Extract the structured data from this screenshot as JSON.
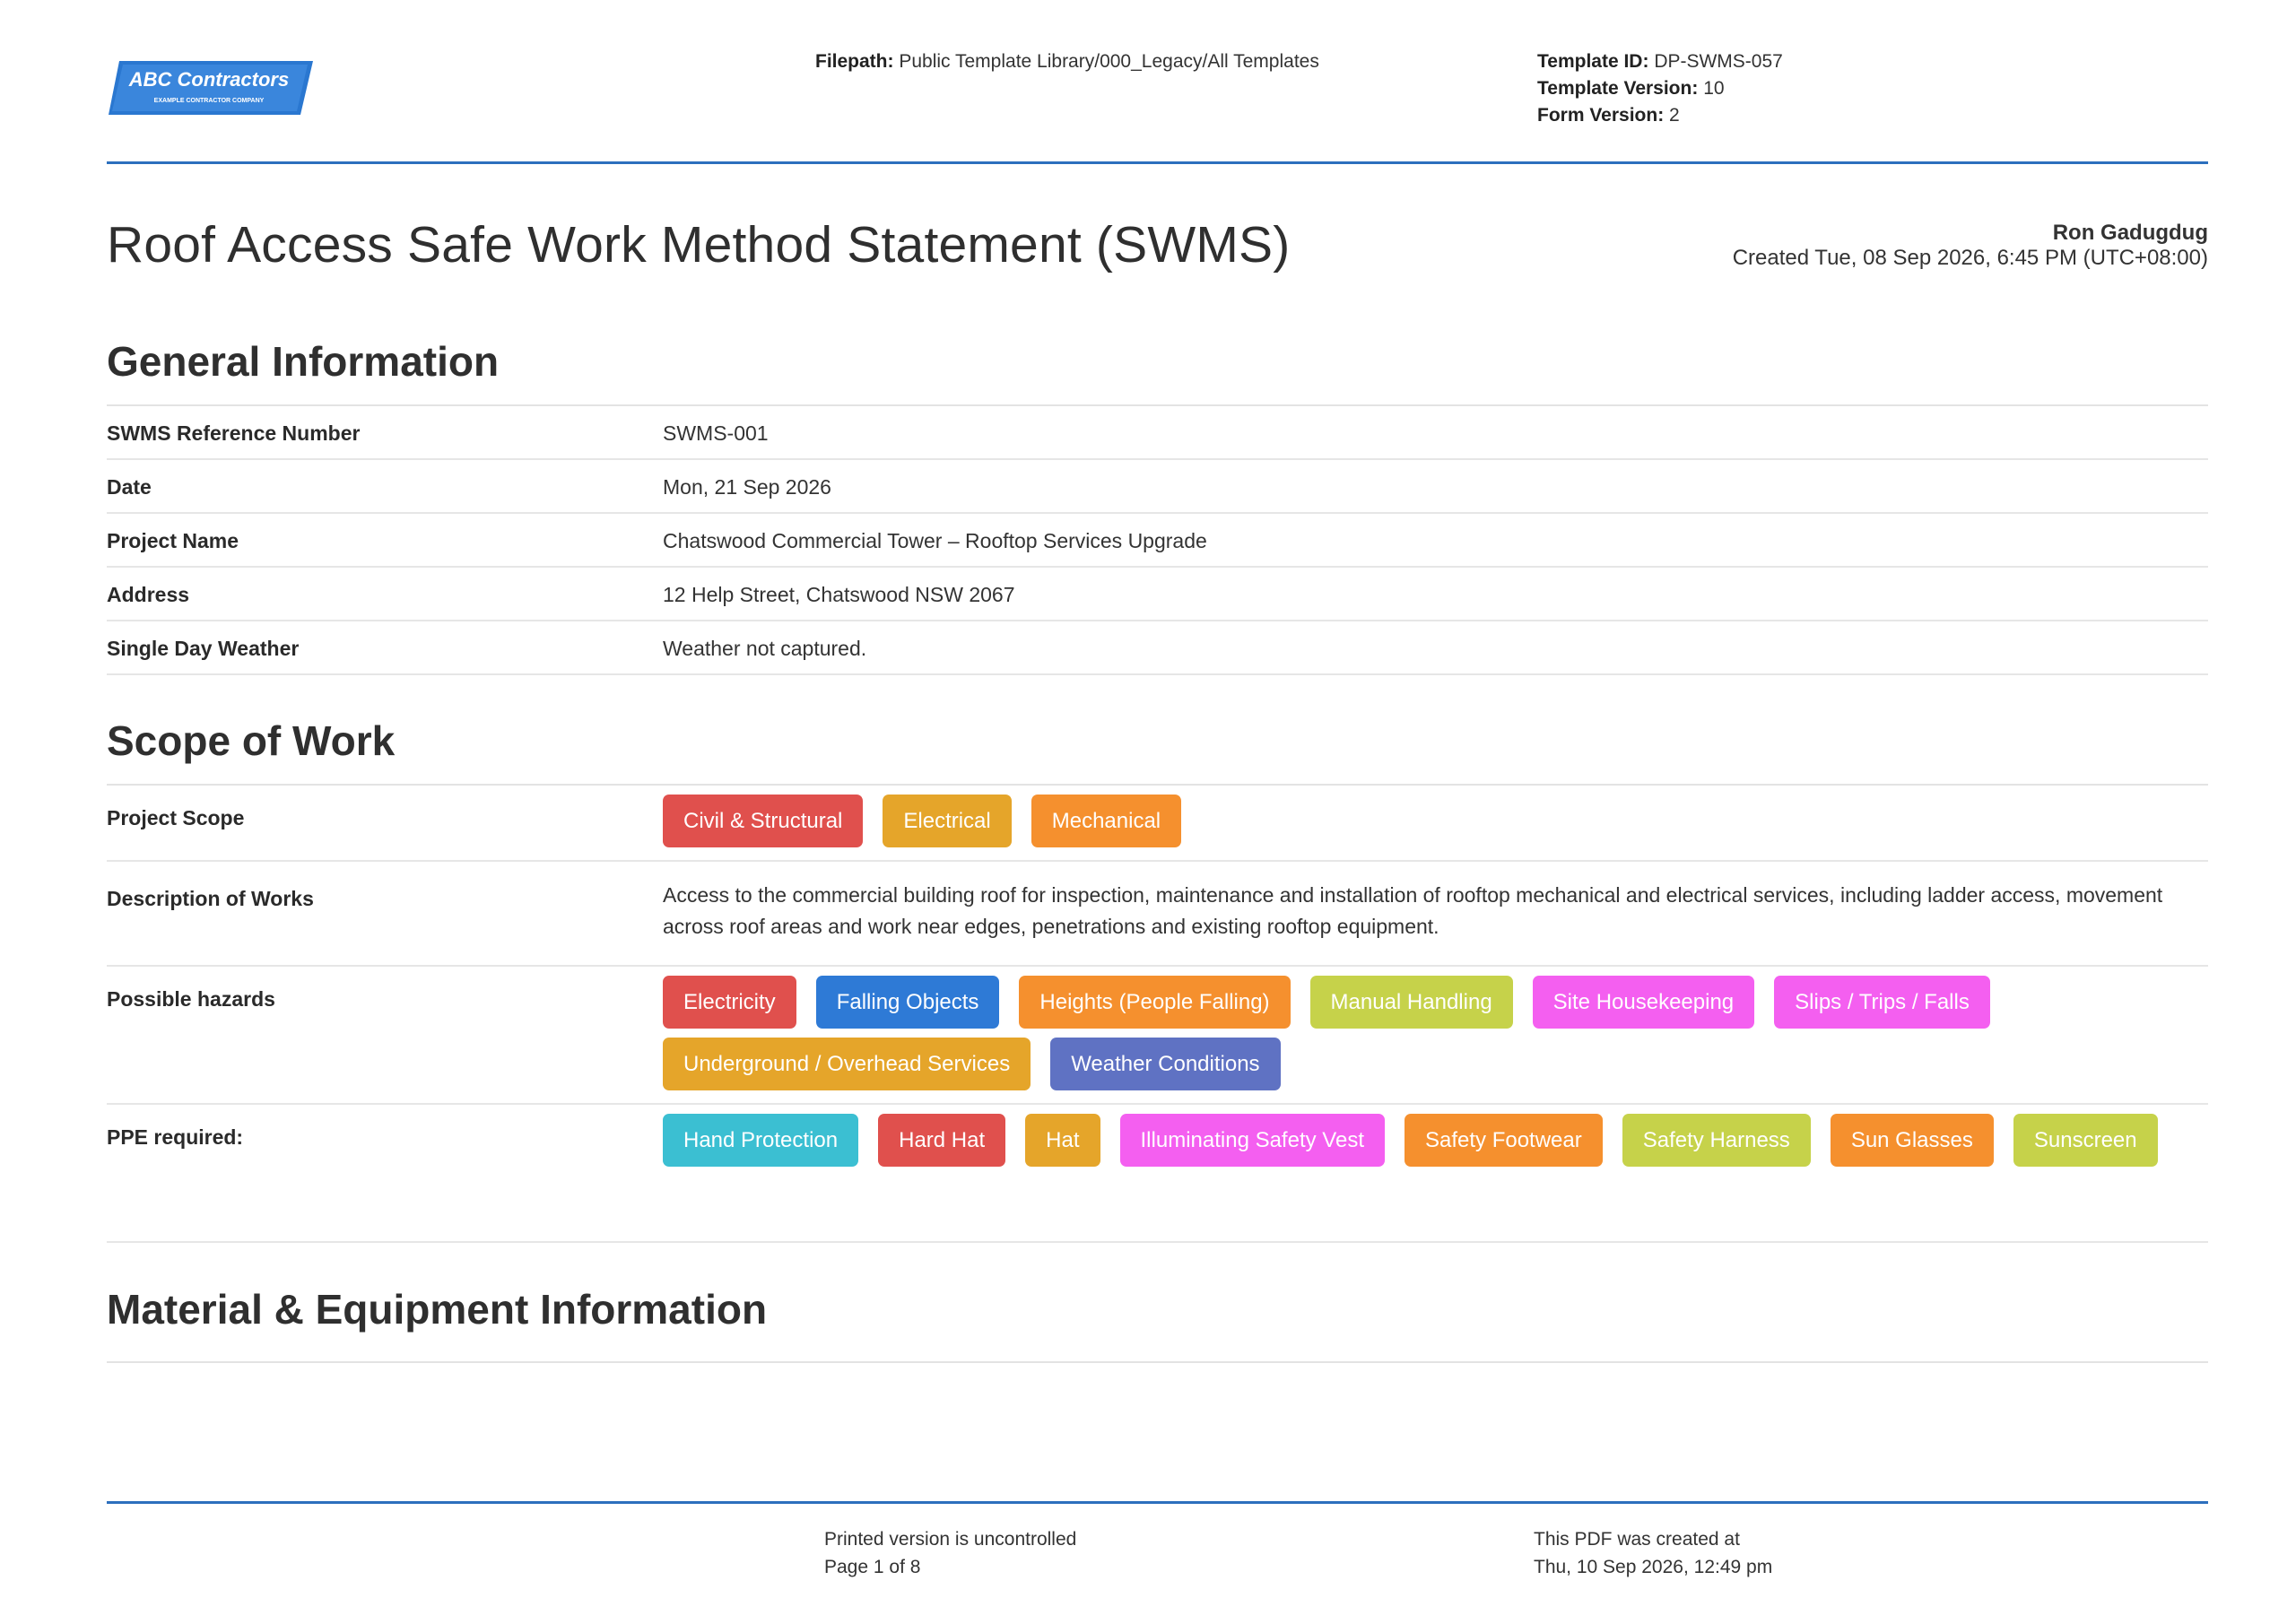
{
  "header": {
    "logo": {
      "name": "ABC Contractors",
      "tagline": "EXAMPLE CONTRACTOR COMPANY",
      "color": "#2a77d0"
    },
    "filepath_label": "Filepath:",
    "filepath_value": "Public Template Library/000_Legacy/All Templates",
    "template_id_label": "Template ID:",
    "template_id_value": "DP-SWMS-057",
    "template_version_label": "Template Version:",
    "template_version_value": "10",
    "form_version_label": "Form Version:",
    "form_version_value": "2"
  },
  "title": "Roof Access Safe Work Method Statement (SWMS)",
  "author": {
    "name": "Ron Gadugdug",
    "created": "Created Tue, 08 Sep 2026, 6:45 PM (UTC+08:00)"
  },
  "general": {
    "heading": "General Information",
    "rows": [
      {
        "label": "SWMS Reference Number",
        "value": "SWMS-001"
      },
      {
        "label": "Date",
        "value": "Mon, 21 Sep 2026"
      },
      {
        "label": "Project Name",
        "value": "Chatswood Commercial Tower – Rooftop Services Upgrade"
      },
      {
        "label": "Address",
        "value": "12 Help Street, Chatswood NSW 2067"
      },
      {
        "label": "Single Day Weather",
        "value": "Weather not captured."
      }
    ]
  },
  "scope": {
    "heading": "Scope of Work",
    "project_scope_label": "Project Scope",
    "project_scope_tags": [
      {
        "text": "Civil & Structural",
        "color": "#e0504d"
      },
      {
        "text": "Electrical",
        "color": "#e5a52a"
      },
      {
        "text": "Mechanical",
        "color": "#f5902e"
      }
    ],
    "description_label": "Description of Works",
    "description_value": "Access to the commercial building roof for inspection, maintenance and installation of rooftop mechanical and electrical services, including ladder access, movement across roof areas and work near edges, penetrations and existing rooftop equipment.",
    "hazards_label": "Possible hazards",
    "hazards_tags": [
      {
        "text": "Electricity",
        "color": "#e0504d"
      },
      {
        "text": "Falling Objects",
        "color": "#2e7ad6"
      },
      {
        "text": "Heights (People Falling)",
        "color": "#f5902e"
      },
      {
        "text": "Manual Handling",
        "color": "#c6d24a"
      },
      {
        "text": "Site Housekeeping",
        "color": "#f45ff0"
      },
      {
        "text": "Slips / Trips / Falls",
        "color": "#f45ff0"
      },
      {
        "text": "Underground / Overhead Services",
        "color": "#e5a52a"
      },
      {
        "text": "Weather Conditions",
        "color": "#5f72c3"
      }
    ],
    "ppe_label": "PPE required:",
    "ppe_tags": [
      {
        "text": "Hand Protection",
        "color": "#3bbfd2"
      },
      {
        "text": "Hard Hat",
        "color": "#e0504d"
      },
      {
        "text": "Hat",
        "color": "#e5a52a"
      },
      {
        "text": "Illuminating Safety Vest",
        "color": "#f45ff0"
      },
      {
        "text": "Safety Footwear",
        "color": "#f5902e"
      },
      {
        "text": "Safety Harness",
        "color": "#c6d24a"
      },
      {
        "text": "Sun Glasses",
        "color": "#f5902e"
      },
      {
        "text": "Sunscreen",
        "color": "#c6d24a"
      }
    ]
  },
  "material": {
    "heading": "Material & Equipment Information"
  },
  "footer": {
    "uncontrolled": "Printed version is uncontrolled",
    "page": "Page 1 of 8",
    "created_label": "This PDF was created at",
    "created_value": "Thu, 10 Sep 2026, 12:49 pm"
  }
}
